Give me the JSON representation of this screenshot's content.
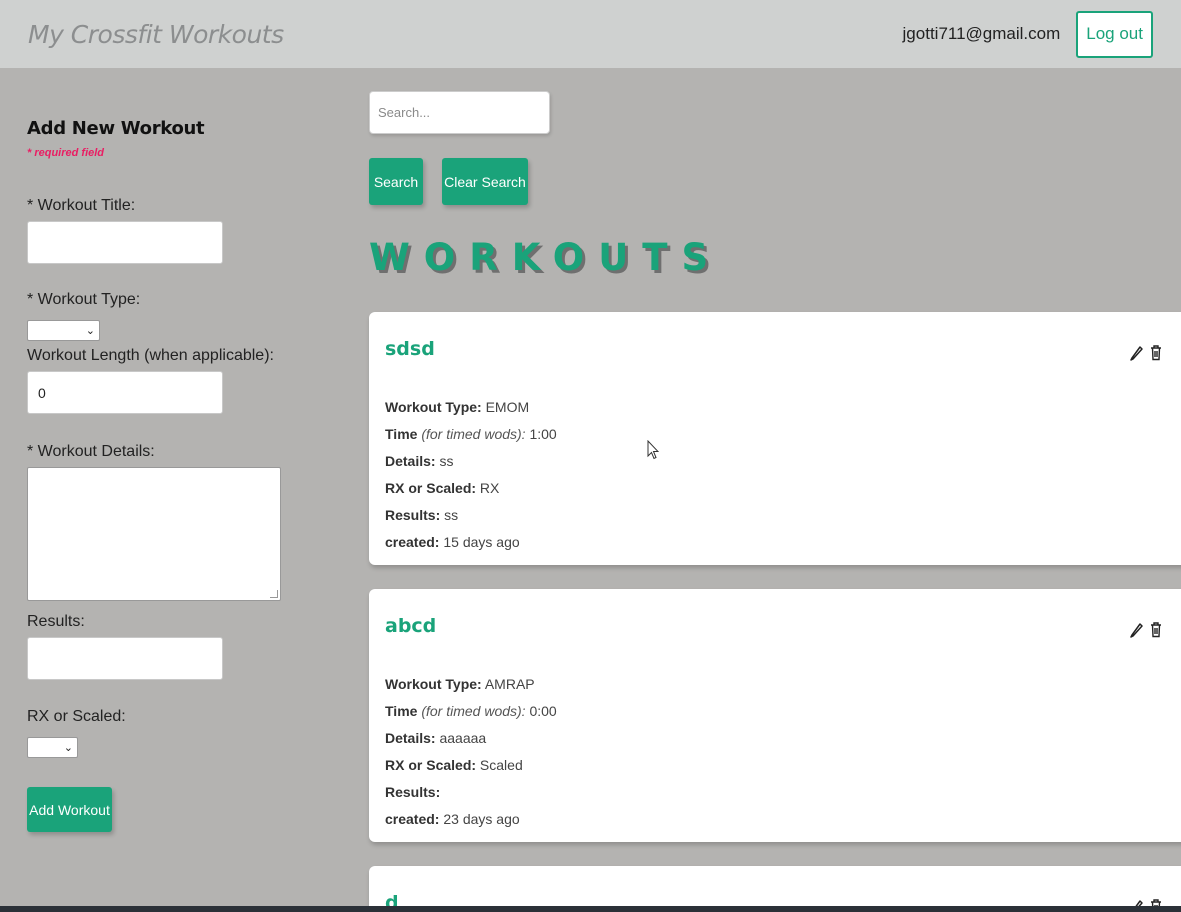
{
  "navbar": {
    "brand": "My Crossfit Workouts",
    "user_email": "jgotti711@gmail.com",
    "logout_label": "Log out"
  },
  "form": {
    "title": "Add New Workout",
    "required_note": "* required field",
    "title_label": "* Workout Title:",
    "title_value": "",
    "type_label": "* Workout Type:",
    "length_label": "Workout Length (when applicable):",
    "length_value": "0",
    "details_label": "* Workout Details:",
    "results_label": "Results:",
    "results_value": "",
    "rx_label": "RX or Scaled:",
    "add_label": "Add Workout"
  },
  "search": {
    "placeholder": "Search...",
    "search_label": "Search",
    "clear_label": "Clear Search"
  },
  "heading": "WORKOUTS",
  "labels": {
    "type": "Workout Type:",
    "time": "Time",
    "time_note": "(for timed wods):",
    "details": "Details:",
    "rx": "RX or Scaled:",
    "results_card1": "Results:",
    "results_card2": "Results:",
    "created": "created:"
  },
  "workouts": [
    {
      "title": "sdsd",
      "type": "EMOM",
      "time": "1:00",
      "details": "ss",
      "rx": "RX",
      "results": "ss",
      "created": "15 days ago"
    },
    {
      "title": "abcd",
      "type": "AMRAP",
      "time": "0:00",
      "details": "aaaaaa",
      "rx": "Scaled",
      "results": "",
      "created": "23 days ago"
    },
    {
      "title": "d"
    }
  ],
  "colors": {
    "accent": "#1aa37a",
    "background": "#b4b3b1",
    "navbar": "#cfd1d0",
    "required": "#e91e63"
  }
}
